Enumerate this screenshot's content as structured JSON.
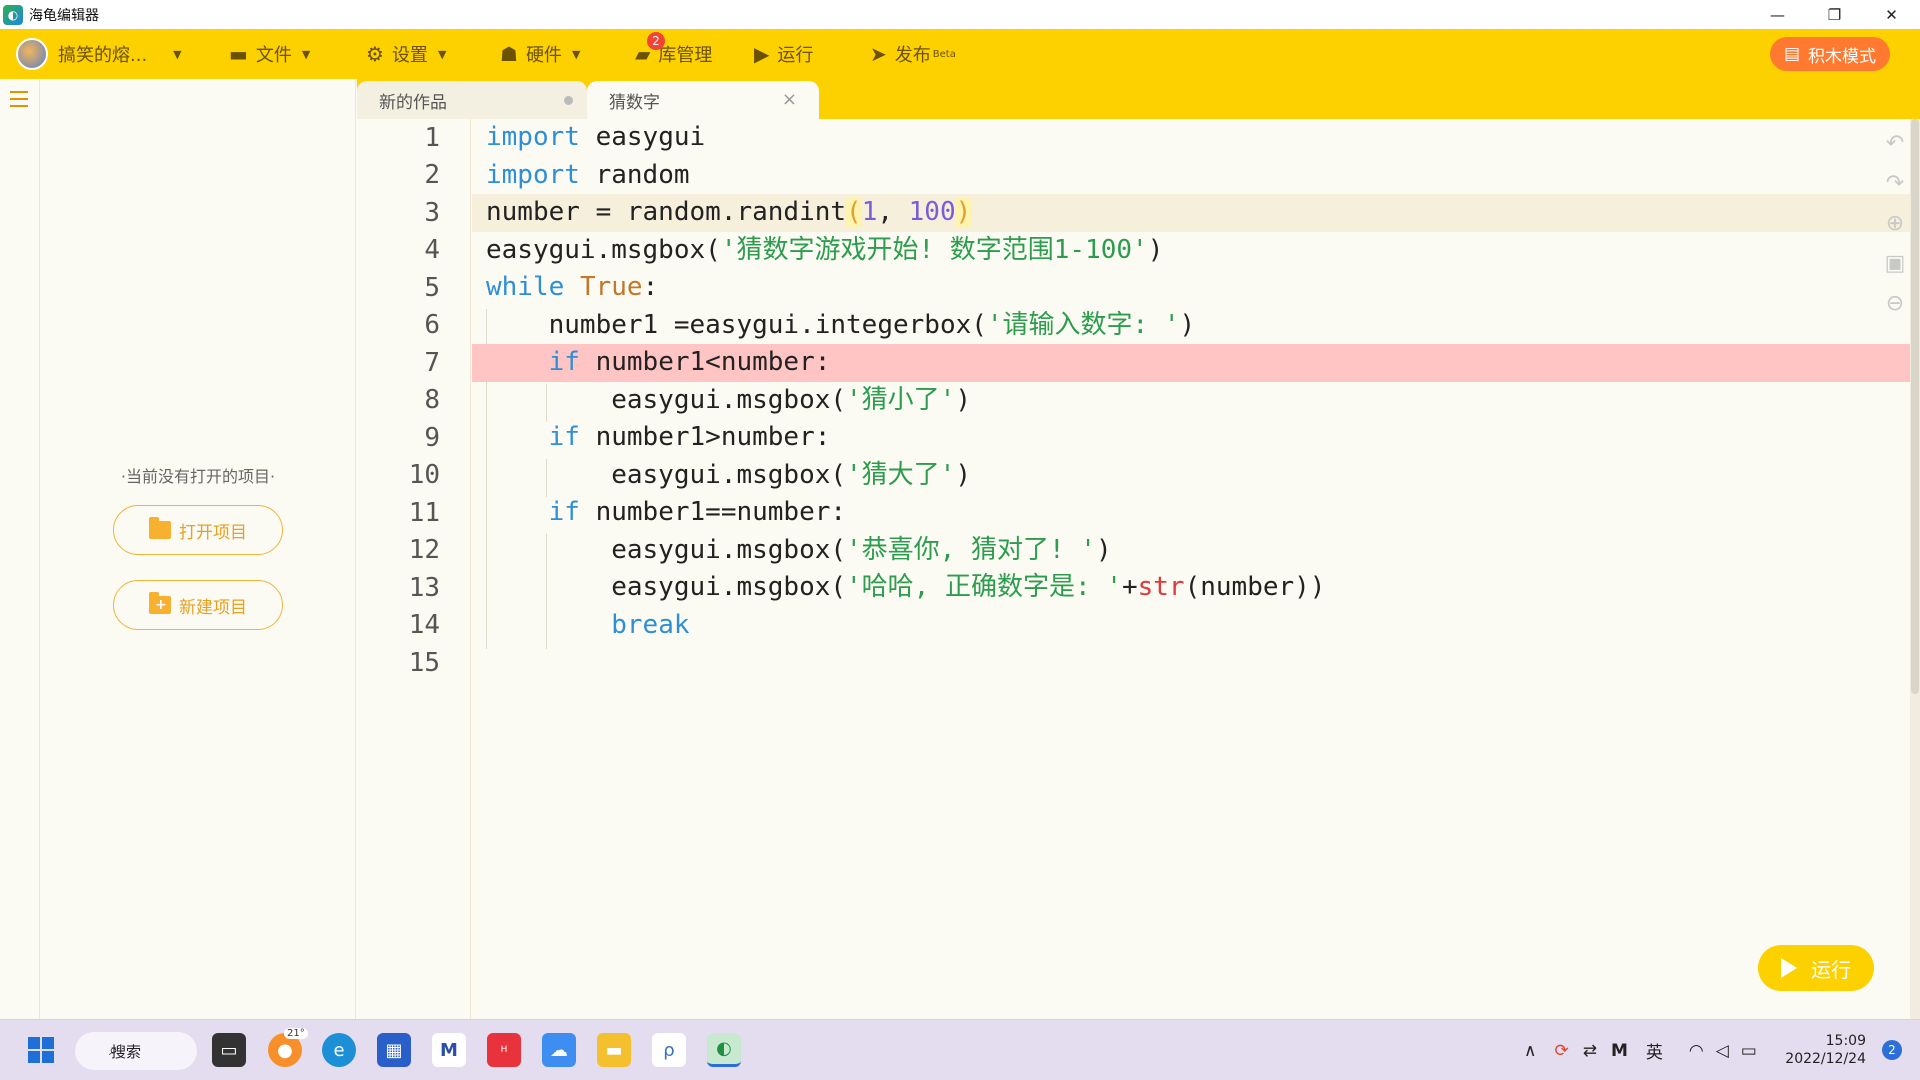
{
  "window": {
    "title": "海龟编辑器",
    "controls": [
      "—",
      "❐",
      "✕"
    ]
  },
  "toolbar": {
    "user_name": "搞笑的熔...",
    "file_label": "文件",
    "settings_label": "设置",
    "hardware_label": "硬件",
    "library_label": "库管理",
    "library_badge": "2",
    "run_label": "运行",
    "publish_label": "发布",
    "publish_beta": "Beta",
    "block_mode_label": "积木模式"
  },
  "project_panel": {
    "empty_text": "·当前没有打开的项目·",
    "open_project_label": "打开项目",
    "new_project_label": "新建项目"
  },
  "tabs": [
    {
      "label": "新的作品"
    },
    {
      "label": "猜数字"
    }
  ],
  "editor": {
    "line_numbers": [
      "1",
      "2",
      "3",
      "4",
      "5",
      "6",
      "7",
      "8",
      "9",
      "10",
      "11",
      "12",
      "13",
      "14",
      "15"
    ],
    "current_line": 3,
    "error_line": 7
  },
  "run_button_label": "运行",
  "taskbar": {
    "search_label": "搜索",
    "weather_temp": "21°",
    "input_method": "英",
    "time": "15:09",
    "date": "2022/12/24",
    "notification_count": "2"
  }
}
